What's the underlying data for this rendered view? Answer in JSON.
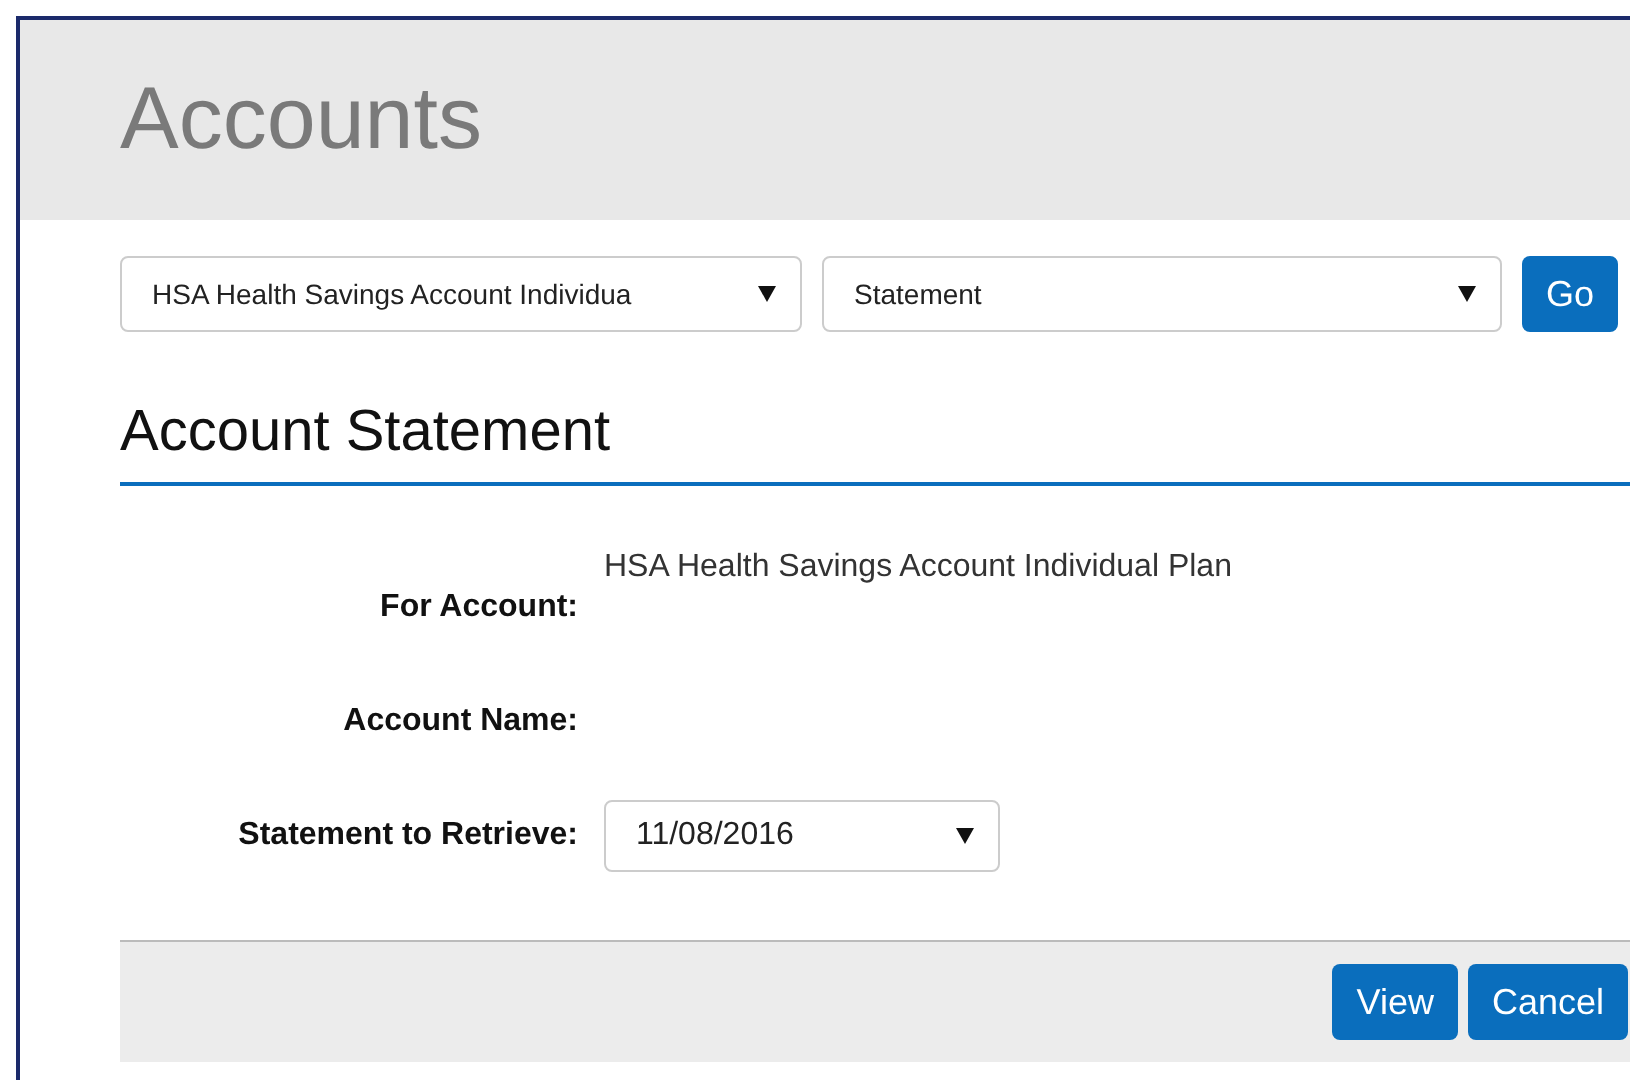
{
  "header": {
    "title": "Accounts"
  },
  "toolbar": {
    "account_select": "HSA Health Savings Account Individua",
    "view_select": "Statement",
    "go_button": "Go"
  },
  "section": {
    "title": "Account Statement"
  },
  "fields": [
    {
      "kind": "text",
      "label": "For Account:",
      "value": "HSA Health Savings Account Individual Plan"
    },
    {
      "kind": "text",
      "label": "Account Name:"
    },
    {
      "kind": "select",
      "label": "Statement to Retrieve:",
      "value": "11/08/2016"
    }
  ],
  "footer": {
    "buttons": [
      "View",
      "Cancel"
    ]
  }
}
